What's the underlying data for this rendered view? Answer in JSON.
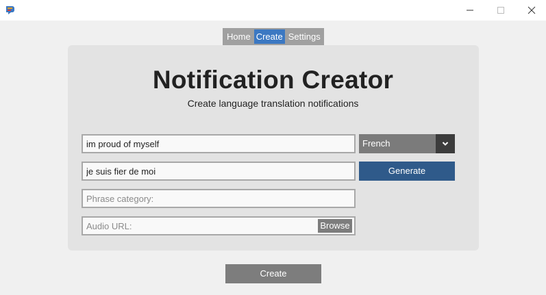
{
  "window": {
    "app_icon": "app-logo-icon",
    "controls": [
      "minimize-icon",
      "maximize-icon",
      "close-icon"
    ]
  },
  "nav": {
    "items": [
      {
        "label": "Home"
      },
      {
        "label": "Create"
      },
      {
        "label": "Settings"
      }
    ],
    "active": "Create",
    "active_color": "#3b78c2"
  },
  "main": {
    "title": "Notification Creator",
    "subtitle": "Create language translation notifications"
  },
  "form": {
    "phrase_value": "im proud of myself",
    "translation_value": "je suis fier de moi",
    "category_placeholder": "Phrase category:",
    "audio_placeholder": "Audio URL:",
    "browse_label": "Browse",
    "language_selected": "French",
    "generate_label": "Generate",
    "generate_color": "#2f5a8a"
  },
  "footer": {
    "create_label": "Create"
  }
}
